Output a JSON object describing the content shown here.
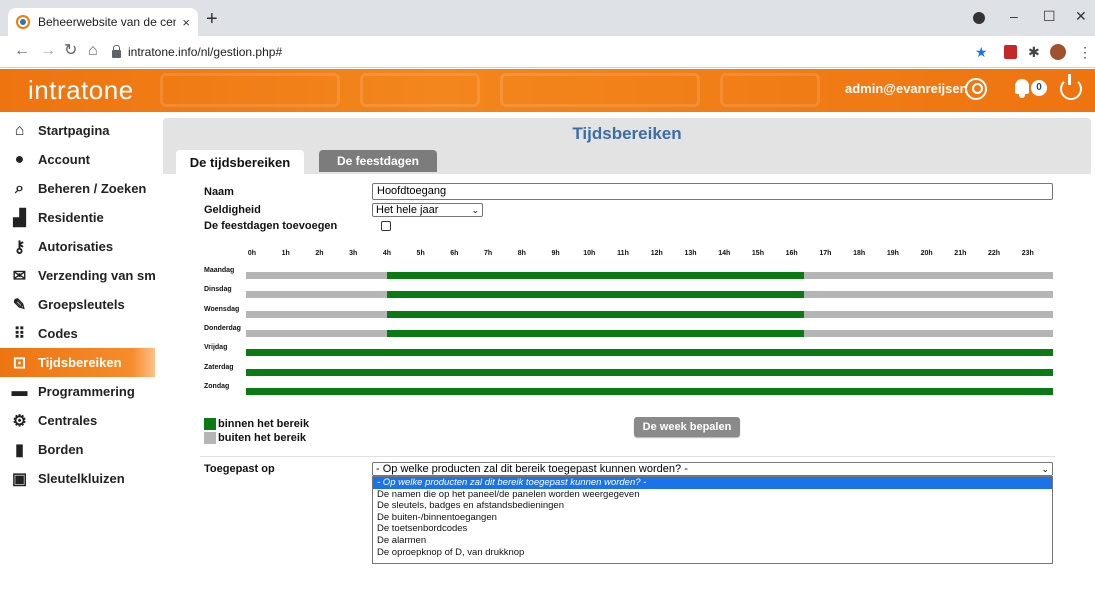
{
  "browser": {
    "tab_title": "Beheerwebsite van de centrales",
    "tab_close": "×",
    "new_tab": "+",
    "url": "intratone.info/nl/gestion.php#",
    "window_controls": [
      "–",
      "☐",
      "✕"
    ]
  },
  "header": {
    "logo": "intratone",
    "user": "admin@evanreijsen",
    "notifications": "0"
  },
  "sidebar": {
    "items": [
      {
        "label": "Startpagina",
        "icon": "home-icon",
        "glyph": "⌂"
      },
      {
        "label": "Account",
        "icon": "user-icon",
        "glyph": "●"
      },
      {
        "label": "Beheren / Zoeken",
        "icon": "search-icon",
        "glyph": "⌕"
      },
      {
        "label": "Residentie",
        "icon": "building-icon",
        "glyph": "▟"
      },
      {
        "label": "Autorisaties",
        "icon": "key-icon",
        "glyph": "⚷"
      },
      {
        "label": "Verzending van sms",
        "icon": "envelope-icon",
        "glyph": "✉"
      },
      {
        "label": "Groepsleutels",
        "icon": "group-key-icon",
        "glyph": "✎"
      },
      {
        "label": "Codes",
        "icon": "keypad-icon",
        "glyph": "⠿"
      },
      {
        "label": "Tijdsbereiken",
        "icon": "calendar-clock-icon",
        "glyph": "⊡"
      },
      {
        "label": "Programmering",
        "icon": "programming-icon",
        "glyph": "▬"
      },
      {
        "label": "Centrales",
        "icon": "gear-icon",
        "glyph": "⚙"
      },
      {
        "label": "Borden",
        "icon": "panel-icon",
        "glyph": "▮"
      },
      {
        "label": "Sleutelkluizen",
        "icon": "safe-icon",
        "glyph": "▣"
      }
    ],
    "active_index": 8
  },
  "panel": {
    "title": "Tijdsbereiken",
    "tab_active": "De tijdsbereiken",
    "tab_inactive": "De feestdagen"
  },
  "form": {
    "naam_label": "Naam",
    "naam_value": "Hoofdtoegang",
    "geldigheid_label": "Geldigheid",
    "geldigheid_value": "Het hele jaar",
    "feestdagen_label": "De feestdagen toevoegen",
    "feestdagen_checked": false
  },
  "schedule": {
    "hours": [
      "0h",
      "1h",
      "2h",
      "3h",
      "4h",
      "5h",
      "6h",
      "7h",
      "8h",
      "9h",
      "10h",
      "11h",
      "12h",
      "13h",
      "14h",
      "15h",
      "16h",
      "17h",
      "18h",
      "19h",
      "20h",
      "21h",
      "22h",
      "23h"
    ],
    "days": [
      {
        "name": "Maandag",
        "in_range_start": 4.2,
        "in_range_end": 16.6
      },
      {
        "name": "Dinsdag",
        "in_range_start": 4.2,
        "in_range_end": 16.6
      },
      {
        "name": "Woensdag",
        "in_range_start": 4.2,
        "in_range_end": 16.6
      },
      {
        "name": "Donderdag",
        "in_range_start": 4.2,
        "in_range_end": 16.6
      },
      {
        "name": "Vrijdag",
        "in_range_start": 0,
        "in_range_end": 24
      },
      {
        "name": "Zaterdag",
        "in_range_start": 0,
        "in_range_end": 24
      },
      {
        "name": "Zondag",
        "in_range_start": 0,
        "in_range_end": 24
      }
    ],
    "colors": {
      "in_range": "#0a7a12",
      "out_range": "#b5b5b5"
    }
  },
  "legend": {
    "in_label": "binnen het bereik",
    "out_label": "buiten het bereik"
  },
  "week_button": "De week bepalen",
  "applied": {
    "label": "Toegepast op",
    "selected": "- Op welke producten zal dit bereik toegepast kunnen worden? -",
    "options": [
      "- Op welke producten zal dit bereik toegepast kunnen worden? -",
      "De namen die op het paneel/de panelen worden weergegeven",
      "De sleutels, badges en afstandsbedieningen",
      "De buiten-/binnentoegangen",
      "De toetsenbordcodes",
      "De alarmen",
      "De oproepknop of D, van drukknop"
    ]
  }
}
